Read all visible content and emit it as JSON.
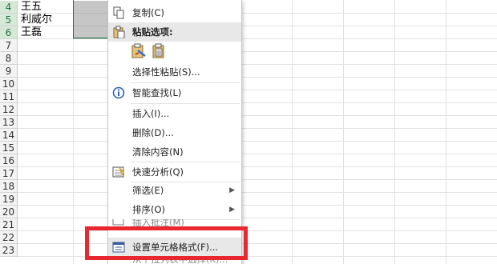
{
  "sheet": {
    "rows": [
      {
        "num": "4",
        "a": "王五"
      },
      {
        "num": "5",
        "a": "利威尔"
      },
      {
        "num": "6",
        "a": "王磊"
      },
      {
        "num": "7",
        "a": ""
      },
      {
        "num": "8",
        "a": ""
      },
      {
        "num": "9",
        "a": ""
      },
      {
        "num": "10",
        "a": ""
      },
      {
        "num": "11",
        "a": ""
      },
      {
        "num": "12",
        "a": ""
      },
      {
        "num": "13",
        "a": ""
      },
      {
        "num": "14",
        "a": ""
      },
      {
        "num": "15",
        "a": ""
      },
      {
        "num": "16",
        "a": ""
      },
      {
        "num": "17",
        "a": ""
      },
      {
        "num": "18",
        "a": ""
      },
      {
        "num": "19",
        "a": ""
      },
      {
        "num": "20",
        "a": ""
      },
      {
        "num": "21",
        "a": ""
      },
      {
        "num": "22",
        "a": ""
      },
      {
        "num": "23",
        "a": ""
      }
    ]
  },
  "menu": {
    "copy": "复制(C)",
    "paste_options": "粘贴选项:",
    "paste_special": "选择性粘贴(S)...",
    "smart_lookup": "智能查找(L)",
    "insert": "插入(I)...",
    "delete": "删除(D)...",
    "clear_contents": "清除内容(N)",
    "quick_analysis": "快速分析(Q)",
    "filter": "筛选(E)",
    "sort": "排序(O)",
    "insert_comment": "插入批注(M)",
    "format_cells": "设置单元格格式(F)...",
    "next_item": "从下拉列表中选择(K)..."
  },
  "colors": {
    "highlight_box": "#e8282e",
    "selection": "#217346"
  }
}
